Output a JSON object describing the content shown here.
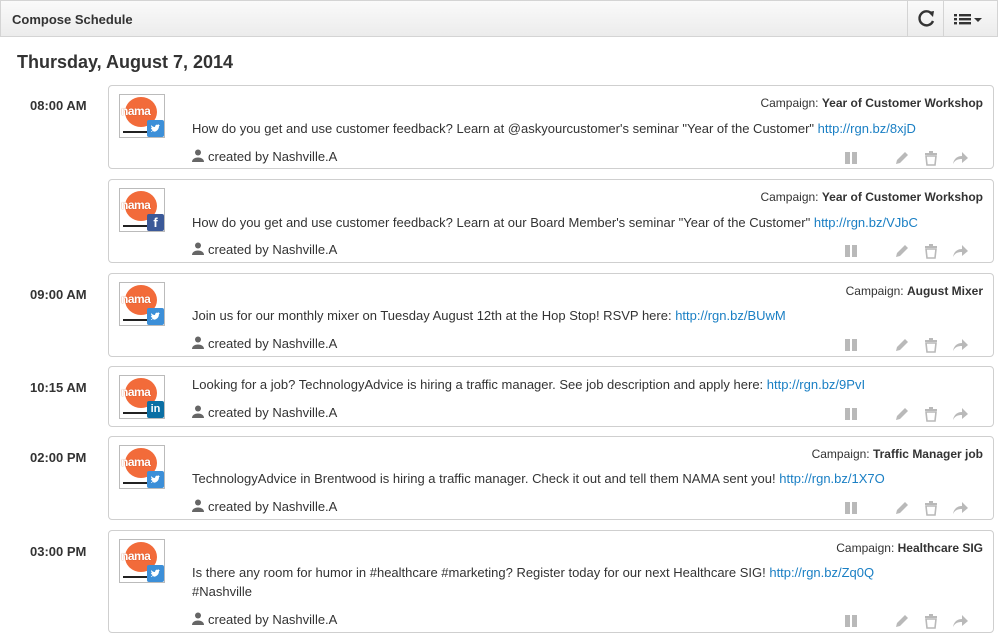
{
  "header": {
    "title": "Compose Schedule"
  },
  "icons": {
    "refresh": "refresh-icon",
    "menu": "list-menu-icon",
    "caret": "caret-down-icon",
    "person": "person-icon",
    "pause": "pause-icon",
    "edit": "pencil-icon",
    "delete": "trash-icon",
    "share": "share-icon"
  },
  "date_heading": "Thursday, August 7, 2014",
  "campaign_prefix": "Campaign:",
  "colors": {
    "link": "#1a7fc4",
    "nama_orange": "#f26b3a",
    "twitter": "#3c8fd8",
    "facebook": "#3b5998",
    "linkedin": "#0b6fa4"
  },
  "posts": [
    {
      "time": "08:00 AM",
      "network": "twitter",
      "network_glyph": "",
      "campaign": "Year of Customer Workshop",
      "text": "How do you get and use customer feedback? Learn at @askyourcustomer's seminar \"Year of the Customer\" ",
      "link": "http://rgn.bz/8xjD",
      "creator": "created by Nashville.A"
    },
    {
      "time": "",
      "network": "facebook",
      "network_glyph": "f",
      "campaign": "Year of Customer Workshop",
      "text": "How do you get and use customer feedback? Learn at our Board Member's seminar \"Year of the Customer\" ",
      "link": "http://rgn.bz/VJbC",
      "creator": "created by Nashville.A"
    },
    {
      "time": "09:00 AM",
      "network": "twitter",
      "network_glyph": "",
      "campaign": "August Mixer",
      "text": "Join us for our monthly mixer on Tuesday August 12th at the Hop Stop! RSVP here: ",
      "link": "http://rgn.bz/BUwM",
      "creator": "created by Nashville.A"
    },
    {
      "time": "10:15 AM",
      "network": "linkedin",
      "network_glyph": "in",
      "campaign": "",
      "text": "Looking for a job? TechnologyAdvice is hiring a traffic manager. See job description and apply here: ",
      "link": "http://rgn.bz/9PvI",
      "creator": "created by Nashville.A"
    },
    {
      "time": "02:00 PM",
      "network": "twitter",
      "network_glyph": "",
      "campaign": "Traffic Manager job",
      "text": "TechnologyAdvice in Brentwood is hiring a traffic manager. Check it out and tell them NAMA sent you! ",
      "link": "http://rgn.bz/1X7O",
      "creator": "created by Nashville.A"
    },
    {
      "time": "03:00 PM",
      "network": "twitter",
      "network_glyph": "",
      "campaign": "Healthcare SIG",
      "text": "Is there any room for humor in #healthcare #marketing? Register today for our next Healthcare SIG! ",
      "link": "http://rgn.bz/Zq0Q",
      "text2": "#Nashville",
      "creator": "created by Nashville.A"
    }
  ],
  "avatar_label": "nama"
}
